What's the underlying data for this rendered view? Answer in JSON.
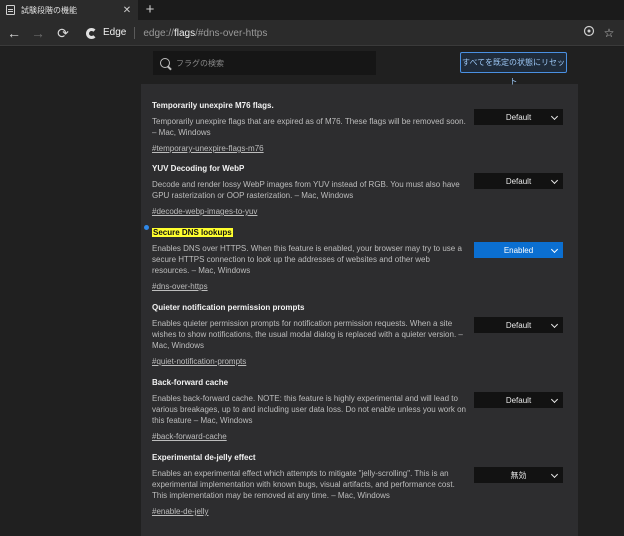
{
  "tab": {
    "title": "試験段階の機能",
    "close": "✕",
    "new_tab": "+"
  },
  "toolbar": {
    "back": "←",
    "forward": "→",
    "reload": "⟳",
    "edge_label": "Edge",
    "url_prefix": "edge://",
    "url_host": "flags",
    "url_suffix": "/#dns-over-https",
    "favorite": "☆"
  },
  "search": {
    "placeholder": "フラグの検索"
  },
  "reset_label": "すべてを既定の状態にリセット",
  "flags": [
    {
      "name": "Temporarily unexpire M76 flags.",
      "desc": "Temporarily unexpire flags that are expired as of M76. These flags will be removed soon. – Mac, Windows",
      "link": "#temporary-unexpire-flags-m76",
      "value": "Default"
    },
    {
      "name": "YUV Decoding for WebP",
      "desc": "Decode and render lossy WebP images from YUV instead of RGB. You must also have GPU rasterization or OOP rasterization. – Mac, Windows",
      "link": "#decode-webp-images-to-yuv",
      "value": "Default"
    },
    {
      "name": "Secure DNS lookups",
      "desc": "Enables DNS over HTTPS. When this feature is enabled, your browser may try to use a secure HTTPS connection to look up the addresses of websites and other web resources. – Mac, Windows",
      "link": "#dns-over-https",
      "value": "Enabled"
    },
    {
      "name": "Quieter notification permission prompts",
      "desc": "Enables quieter permission prompts for notification permission requests. When a site wishes to show notifications, the usual modal dialog is replaced with a quieter version. – Mac, Windows",
      "link": "#quiet-notification-prompts",
      "value": "Default"
    },
    {
      "name": "Back-forward cache",
      "desc": "Enables back-forward cache. NOTE: this feature is highly experimental and will lead to various breakages, up to and including user data loss. Do not enable unless you work on this feature – Mac, Windows",
      "link": "#back-forward-cache",
      "value": "Default"
    },
    {
      "name": "Experimental de-jelly effect",
      "desc": "Enables an experimental effect which attempts to mitigate \"jelly-scrolling\". This is an experimental implementation with known bugs, visual artifacts, and performance cost. This implementation may be removed at any time. – Mac, Windows",
      "link": "#enable-de-jelly",
      "value": "無効"
    }
  ],
  "colors": {
    "accent": "#0b6fd1",
    "highlight": "#ffff2e",
    "background": "#2d2d2f"
  }
}
